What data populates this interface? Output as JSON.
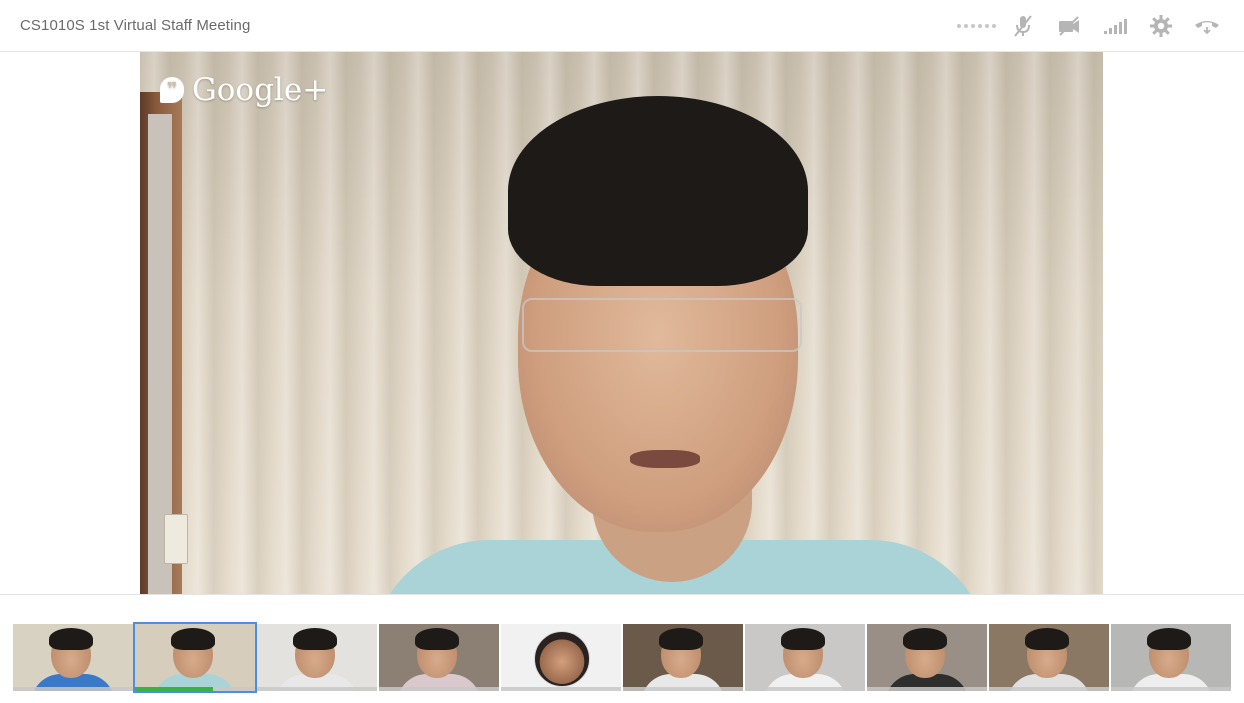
{
  "header": {
    "title": "CS1010S 1st Virtual Staff Meeting",
    "controls": [
      {
        "icon": "more-dots-icon",
        "label": "More"
      },
      {
        "icon": "mic-muted-icon",
        "label": "Mute microphone"
      },
      {
        "icon": "camera-off-icon",
        "label": "Turn camera off"
      },
      {
        "icon": "signal-bars-icon",
        "label": "Bandwidth"
      },
      {
        "icon": "gear-icon",
        "label": "Settings"
      },
      {
        "icon": "hang-up-icon",
        "label": "Exit"
      }
    ]
  },
  "stage": {
    "watermark": "Google+",
    "watermark_icon": "hangouts-quote-icon"
  },
  "colors": {
    "accent_selected": "#4a90e2",
    "speaking_indicator": "#3cb043",
    "title_text": "#6b6b6b",
    "control_icon": "#b5b5b5"
  },
  "filmstrip": {
    "participants": [
      {
        "id": "p1",
        "type": "video",
        "bg": "#d8d2c2",
        "shirt": "#3a78c8",
        "selected": false,
        "speaking": false
      },
      {
        "id": "p2",
        "type": "video",
        "bg": "#d6cdbc",
        "shirt": "#a9d3d7",
        "selected": true,
        "speaking": true
      },
      {
        "id": "p3",
        "type": "video",
        "bg": "#e4e2de",
        "shirt": "#e8e8e8",
        "selected": false,
        "speaking": false
      },
      {
        "id": "p4",
        "type": "video",
        "bg": "#8c7f74",
        "shirt": "#d9c8cc",
        "selected": false,
        "speaking": false
      },
      {
        "id": "p5",
        "type": "avatar",
        "bg": "#f1f1f1",
        "shirt": "#f1f1f1",
        "selected": false,
        "speaking": false
      },
      {
        "id": "p6",
        "type": "video",
        "bg": "#6b5a4a",
        "shirt": "#e8e8e8",
        "selected": false,
        "speaking": false
      },
      {
        "id": "p7",
        "type": "video",
        "bg": "#c9c8c6",
        "shirt": "#f0f0f0",
        "selected": false,
        "speaking": false
      },
      {
        "id": "p8",
        "type": "video",
        "bg": "#9a8f86",
        "shirt": "#2e2e2e",
        "selected": false,
        "speaking": false
      },
      {
        "id": "p9",
        "type": "video",
        "bg": "#8a7764",
        "shirt": "#e0e0e0",
        "selected": false,
        "speaking": false
      },
      {
        "id": "p10",
        "type": "video",
        "bg": "#b7b7b5",
        "shirt": "#eeeeee",
        "selected": false,
        "speaking": false
      }
    ]
  }
}
